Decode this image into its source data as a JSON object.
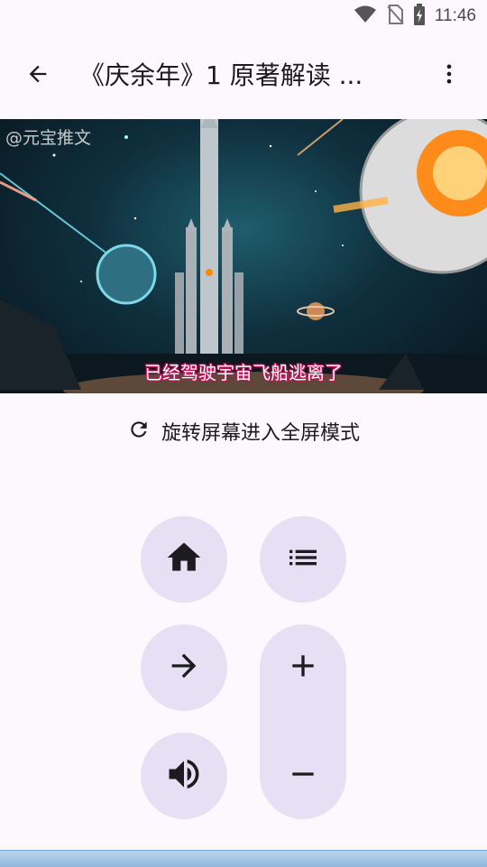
{
  "status_bar": {
    "time": "11:46",
    "icons": [
      "wifi-icon",
      "no-sim-icon",
      "battery-icon"
    ]
  },
  "app_bar": {
    "title": "《庆余年》1 原著解读 ...",
    "back_icon": "arrow-back-icon",
    "more_icon": "more-vert-icon"
  },
  "video": {
    "watermark": "@元宝推文",
    "subtitle": "已经驾驶宇宙飞船逃离了"
  },
  "rotate": {
    "label": "旋转屏幕进入全屏模式",
    "icon": "refresh-icon"
  },
  "controls": {
    "home_icon": "home-icon",
    "list_icon": "list-icon",
    "next_icon": "arrow-forward-icon",
    "volume_icon": "volume-up-icon",
    "plus_icon": "plus-icon",
    "minus_icon": "minus-icon",
    "button_color": "#e7e0f4",
    "icon_color": "#1c1b1f"
  }
}
